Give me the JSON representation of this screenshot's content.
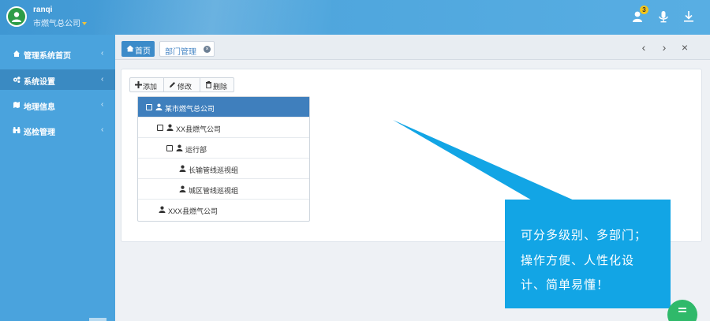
{
  "header": {
    "username": "ranqi",
    "company": "市燃气总公司",
    "notification_count": "3"
  },
  "sidebar": {
    "items": [
      {
        "label": "管理系统首页",
        "icon": "home-icon"
      },
      {
        "label": "系统设置",
        "icon": "gears-icon"
      },
      {
        "label": "地理信息",
        "icon": "map-icon"
      },
      {
        "label": "巡检管理",
        "icon": "binoculars-icon"
      }
    ]
  },
  "tabs": {
    "home_label": "首页",
    "active_label": "部门管理"
  },
  "nav": {
    "prev": "‹",
    "next": "›",
    "close": "×"
  },
  "toolbar": {
    "add_label": "添加",
    "edit_label": "修改",
    "delete_label": "删除"
  },
  "tree": {
    "nodes": [
      {
        "label": "某市燃气总公司",
        "level": 0,
        "checkbox": true,
        "selected": true
      },
      {
        "label": "XX县燃气公司",
        "level": 1,
        "checkbox": true,
        "selected": false
      },
      {
        "label": "运行部",
        "level": 2,
        "checkbox": true,
        "selected": false
      },
      {
        "label": "长输管线巡视组",
        "level": 3,
        "checkbox": false,
        "selected": false
      },
      {
        "label": "城区管线巡视组",
        "level": 3,
        "checkbox": false,
        "selected": false
      },
      {
        "label": "XXX县燃气公司",
        "level": 1,
        "checkbox": false,
        "selected": false
      }
    ]
  },
  "callout": {
    "lines": [
      "可分多级别、多部门；",
      "操作方便、人性化设",
      "计、简单易懂！"
    ]
  },
  "colors": {
    "topbar": "#4aa3dd",
    "sidebar": "#4aa3dd",
    "sidebar_active": "#3a8ac2",
    "selected_node": "#3f7fbd",
    "callout": "#12a5e5",
    "fab": "#2fb96a",
    "badge": "#f3c51a"
  }
}
